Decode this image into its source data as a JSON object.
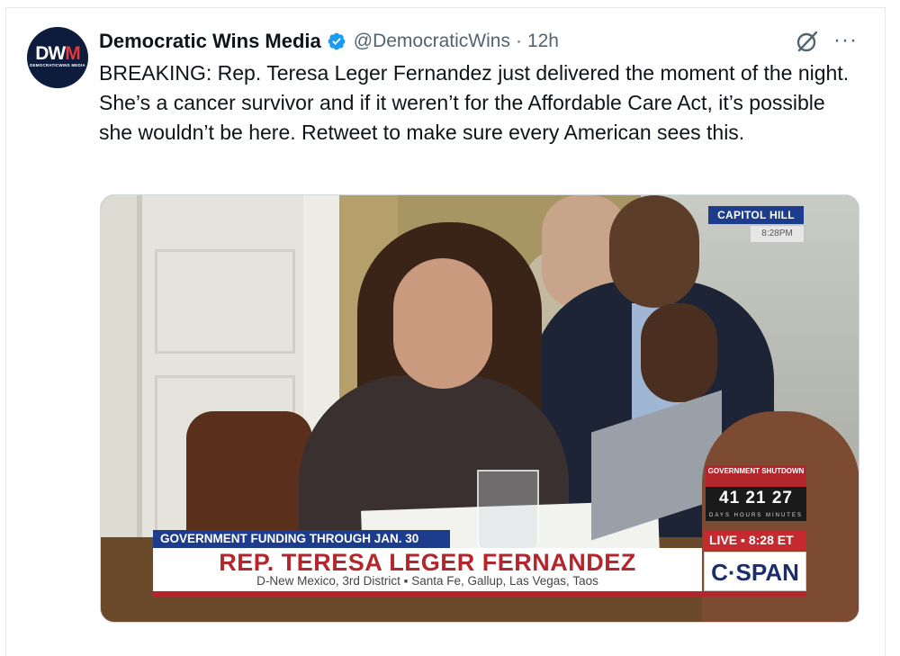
{
  "tweet": {
    "avatar": {
      "logo_main": "DW",
      "logo_accent": "M",
      "logo_sub": "DEMOCRATICWINS MEDIA"
    },
    "display_name": "Democratic Wins Media",
    "verified": true,
    "handle": "@DemocraticWins",
    "separator": "·",
    "time": "12h",
    "more": "···",
    "text": "BREAKING: Rep. Teresa Leger Fernandez just delivered the moment of the night. She’s a cancer survivor and if it weren’t for the Affordable Care Act, it’s possible she wouldn’t be here. Retweet to make sure every American sees this.",
    "icons": {
      "grok": "grok-icon",
      "more": "more-icon",
      "verified": "verified-badge-icon"
    },
    "colors": {
      "verified": "#1d9bf0",
      "secondary_text": "#536471"
    }
  },
  "media": {
    "overlay": {
      "location": "CAPITOL HILL",
      "location_time": "8:28PM",
      "shutdown_label": "GOVERNMENT SHUTDOWN",
      "countdown": "41 21 27",
      "countdown_units": "DAYS HOURS MINUTES",
      "live": "LIVE ▪ 8:28 ET",
      "network": "C·SPAN",
      "headline": "GOVERNMENT FUNDING THROUGH JAN. 30",
      "name": "REP. TERESA LEGER FERNANDEZ",
      "detail": "D-New Mexico, 3rd District  ▪  Santa Fe, Gallup, Las Vegas, Taos"
    },
    "colors": {
      "cspan_blue": "#1e3c8c",
      "cspan_red": "#b3262c"
    }
  }
}
